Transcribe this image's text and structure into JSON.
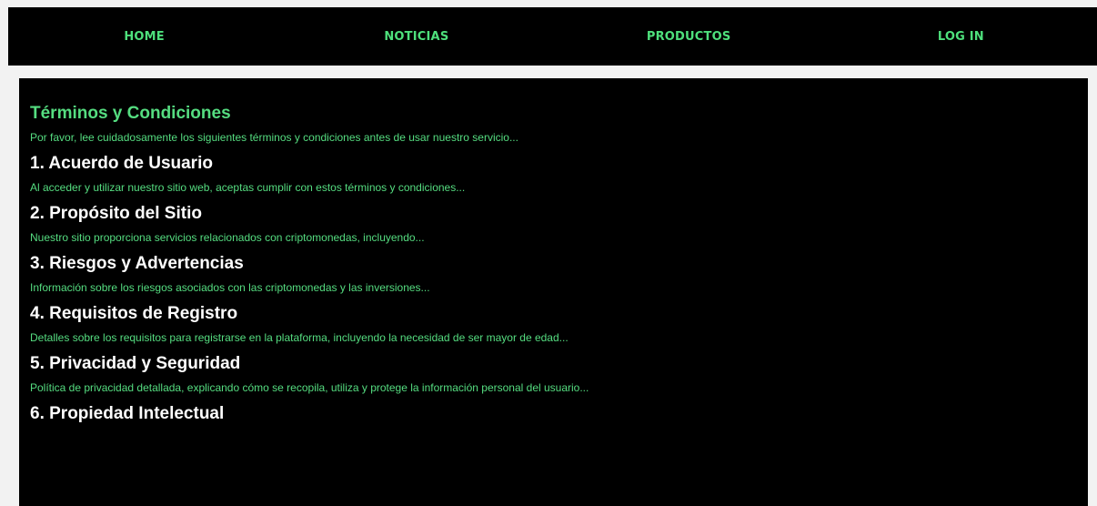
{
  "nav": {
    "items": [
      {
        "label": "HOME"
      },
      {
        "label": "NOTICIAS"
      },
      {
        "label": "PRODUCTOS"
      },
      {
        "label": "LOG IN"
      }
    ]
  },
  "colors": {
    "accent": "#55dd80",
    "background": "#000000",
    "page": "#f2f2f2",
    "heading": "#ffffff"
  },
  "main": {
    "title": "Términos y Condiciones",
    "intro": "Por favor, lee cuidadosamente los siguientes términos y condiciones antes de usar nuestro servicio...",
    "sections": [
      {
        "heading": "1. Acuerdo de Usuario",
        "text": "Al acceder y utilizar nuestro sitio web, aceptas cumplir con estos términos y condiciones..."
      },
      {
        "heading": "2. Propósito del Sitio",
        "text": "Nuestro sitio proporciona servicios relacionados con criptomonedas, incluyendo..."
      },
      {
        "heading": "3. Riesgos y Advertencias",
        "text": "Información sobre los riesgos asociados con las criptomonedas y las inversiones..."
      },
      {
        "heading": "4. Requisitos de Registro",
        "text": "Detalles sobre los requisitos para registrarse en la plataforma, incluyendo la necesidad de ser mayor de edad..."
      },
      {
        "heading": "5. Privacidad y Seguridad",
        "text": "Política de privacidad detallada, explicando cómo se recopila, utiliza y protege la información personal del usuario..."
      },
      {
        "heading": "6. Propiedad Intelectual"
      }
    ]
  }
}
